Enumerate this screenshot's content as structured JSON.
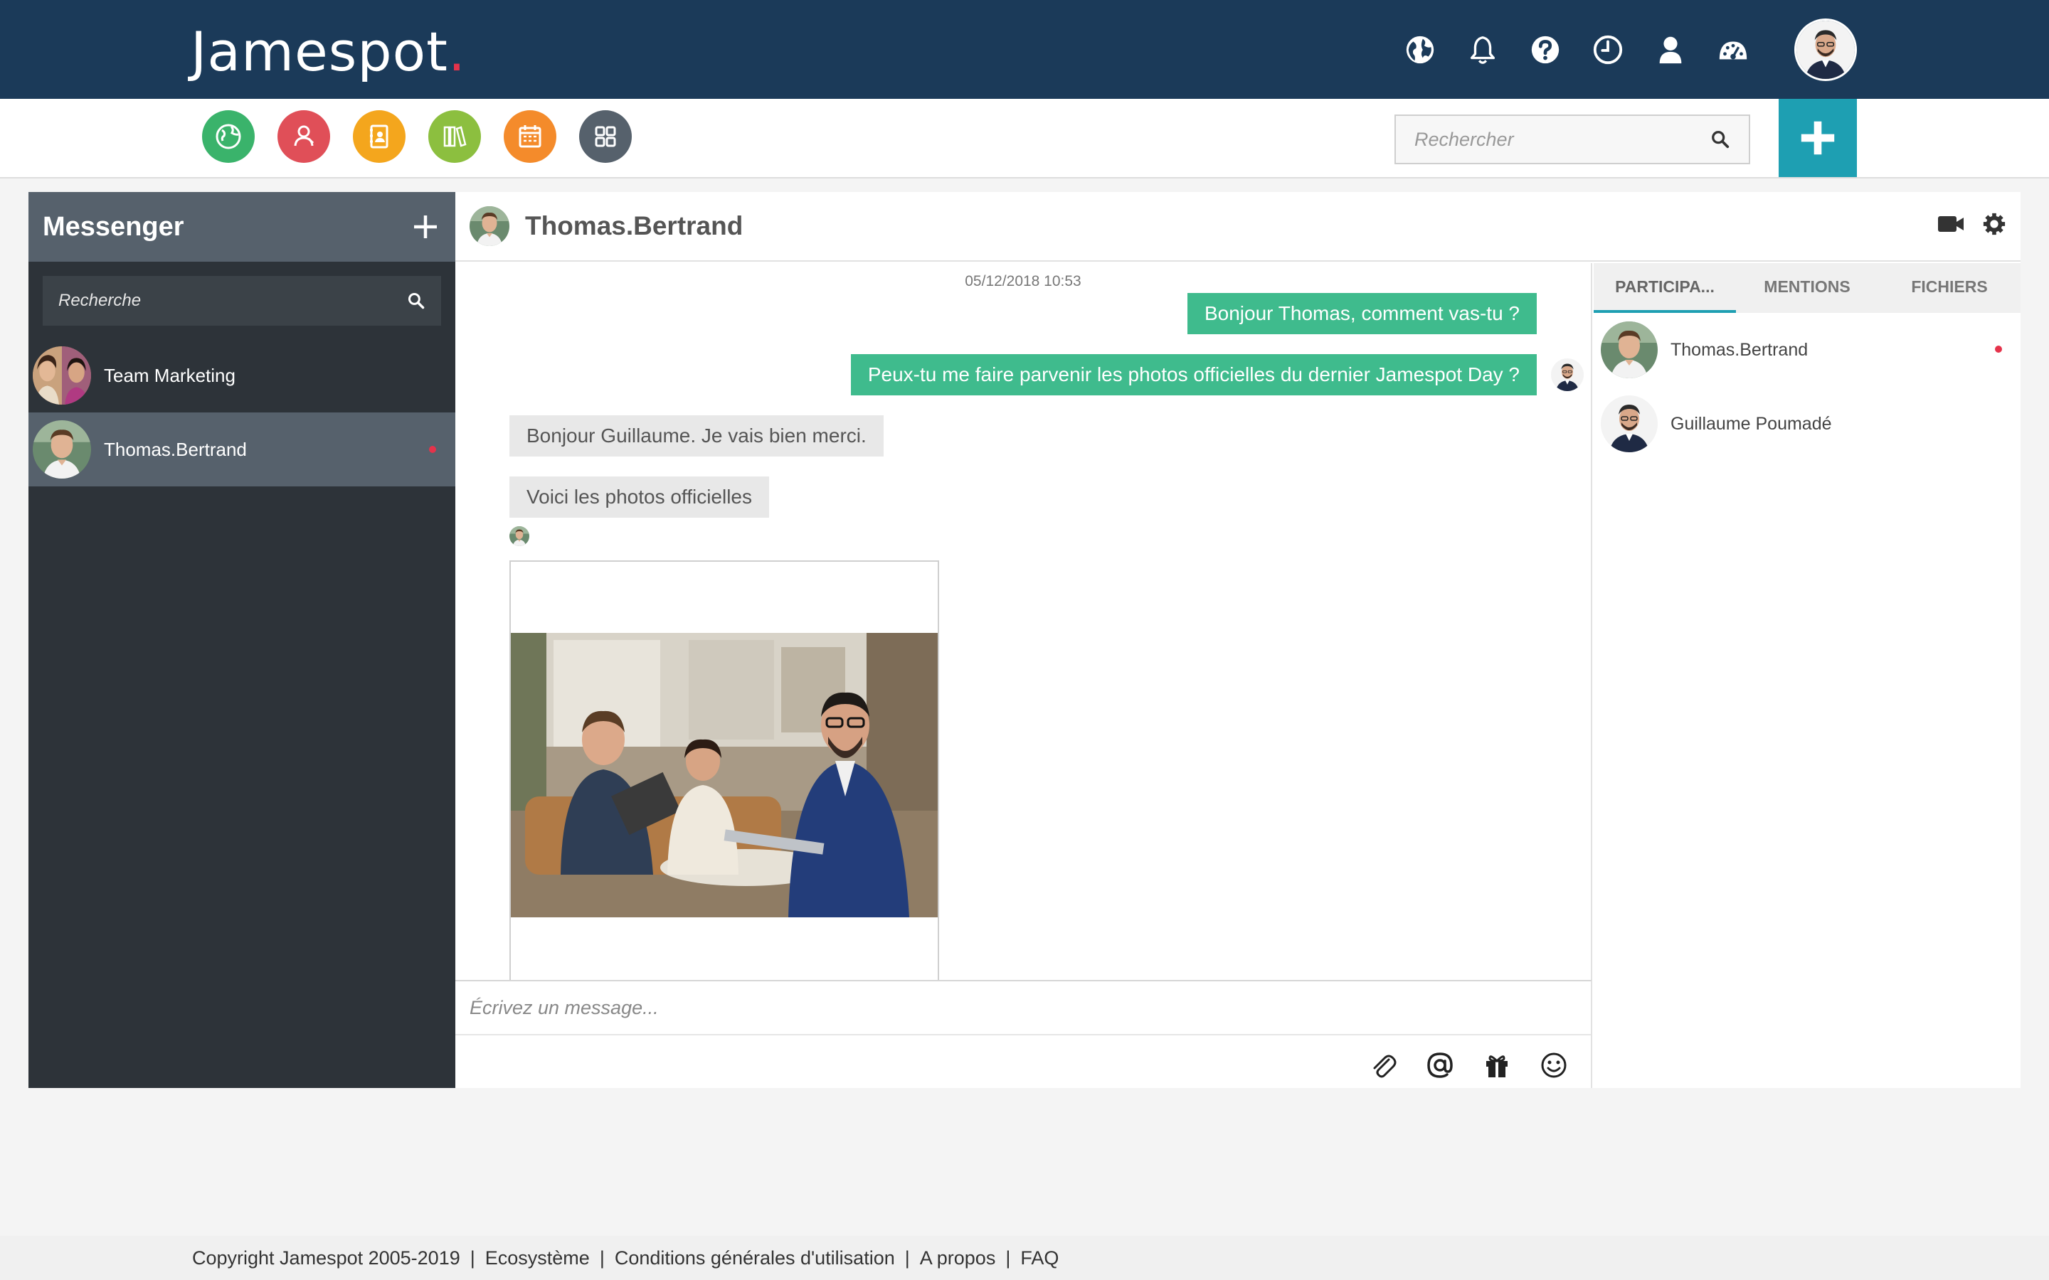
{
  "brand": {
    "name": "Jamespot",
    "dot": "."
  },
  "header": {
    "icons": [
      "globe-icon",
      "bell-icon",
      "help-icon",
      "clock-icon",
      "user-icon",
      "dashboard-icon"
    ]
  },
  "apps": {
    "items": [
      {
        "name": "globe-app",
        "color": "#3ab36b"
      },
      {
        "name": "contacts-app",
        "color": "#e04f58"
      },
      {
        "name": "directory-app",
        "color": "#f4a61d"
      },
      {
        "name": "library-app",
        "color": "#8cbf3f"
      },
      {
        "name": "calendar-app",
        "color": "#f48b2b"
      },
      {
        "name": "apps-grid",
        "color": "#56616c"
      }
    ],
    "search_placeholder": "Rechercher",
    "add_color": "#1e9fb2"
  },
  "messenger": {
    "title": "Messenger",
    "search_placeholder": "Recherche",
    "conversations": [
      {
        "name": "Team Marketing"
      },
      {
        "name": "Thomas.Bertrand"
      }
    ]
  },
  "chat": {
    "title": "Thomas.Bertrand",
    "timestamp": "05/12/2018 10:53",
    "messages": [
      {
        "text": "Bonjour Thomas, comment vas-tu ?"
      },
      {
        "text": "Peux-tu me faire parvenir les photos officielles du dernier Jamespot Day ?"
      },
      {
        "text": "Bonjour Guillaume. Je vais bien merci."
      },
      {
        "text": "Voici les photos officielles"
      }
    ],
    "composer_placeholder": "Écrivez un message..."
  },
  "panel": {
    "tabs": [
      "PARTICIPA...",
      "MENTIONS",
      "FICHIERS"
    ],
    "participants": [
      {
        "name": "Thomas.Bertrand"
      },
      {
        "name": "Guillaume Poumadé"
      }
    ]
  },
  "footer": {
    "copyright": "Copyright Jamespot 2005-2019",
    "links": [
      "Ecosystème",
      "Conditions générales d'utilisation",
      "A propos",
      "FAQ"
    ]
  },
  "colors": {
    "topbar": "#1b3a59",
    "accent": "#1e9fb2",
    "bubble_out": "#3fbb8d",
    "notification": "#e5334b"
  }
}
